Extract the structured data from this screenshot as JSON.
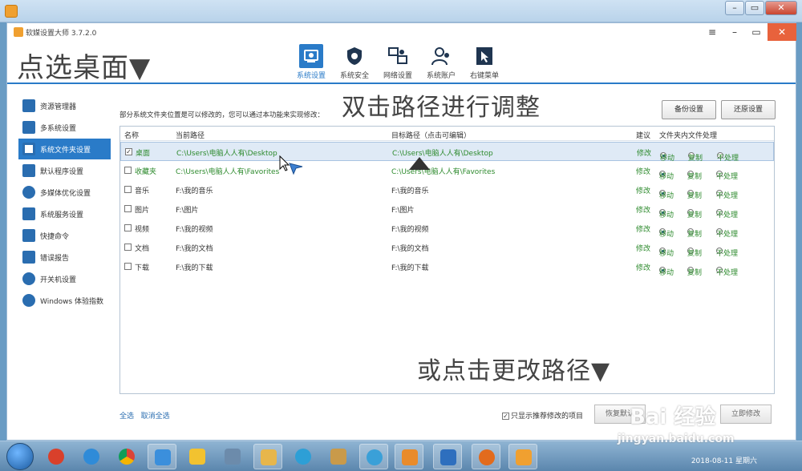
{
  "window": {
    "title": "软媒设置大师 3.7.2.0",
    "menu_icon": "≡",
    "min_icon": "–",
    "max_icon": "▭",
    "close_icon": "✕"
  },
  "annotations": {
    "left": "点选桌面▼",
    "middle": "双击路径进行调整",
    "bottom": "或点击更改路径▼"
  },
  "nav": [
    {
      "label": "系统设置",
      "icon": "gear-icon",
      "active": true
    },
    {
      "label": "系统安全",
      "icon": "shield-icon"
    },
    {
      "label": "网络设置",
      "icon": "network-icon"
    },
    {
      "label": "系统账户",
      "icon": "users-icon"
    },
    {
      "label": "右键菜单",
      "icon": "cursor-icon"
    }
  ],
  "sidebar": [
    {
      "label": "资源管理器"
    },
    {
      "label": "多系统设置"
    },
    {
      "label": "系统文件夹设置",
      "active": true
    },
    {
      "label": "默认程序设置"
    },
    {
      "label": "多媒体优化设置"
    },
    {
      "label": "系统服务设置"
    },
    {
      "label": "快捷命令"
    },
    {
      "label": "错误报告"
    },
    {
      "label": "开关机设置"
    },
    {
      "label": "Windows 体验指数"
    }
  ],
  "description": "部分系统文件夹位置是可以修改的，您可以通过本功能来实现修改：",
  "buttons": {
    "backup": "备份设置",
    "restore": "还原设置"
  },
  "table": {
    "headers": {
      "name": "名称",
      "current": "当前路径",
      "target": "目标路径（点击可编辑）",
      "suggest": "建议",
      "handling": "文件夹内文件处理"
    },
    "options": [
      "移动",
      "复制",
      "不处理"
    ],
    "rows": [
      {
        "name": "桌面",
        "current": "C:\\Users\\电脑人人有\\Desktop",
        "target": "C:\\Users\\电脑人人有\\Desktop",
        "suggest": "修改",
        "checked": true,
        "highlight": true
      },
      {
        "name": "收藏夹",
        "current": "C:\\Users\\电脑人人有\\Favorites",
        "target": "C:\\Users\\电脑人人有\\Favorites",
        "suggest": "修改",
        "checked": false,
        "highlight": true
      },
      {
        "name": "音乐",
        "current": "F:\\我的音乐",
        "target": "F:\\我的音乐",
        "suggest": "修改",
        "checked": false
      },
      {
        "name": "图片",
        "current": "F:\\图片",
        "target": "F:\\图片",
        "suggest": "修改",
        "checked": false
      },
      {
        "name": "视频",
        "current": "F:\\我的视频",
        "target": "F:\\我的视频",
        "suggest": "修改",
        "checked": false
      },
      {
        "name": "文档",
        "current": "F:\\我的文档",
        "target": "F:\\我的文档",
        "suggest": "修改",
        "checked": false
      },
      {
        "name": "下载",
        "current": "F:\\我的下载",
        "target": "F:\\我的下载",
        "suggest": "修改",
        "checked": false
      }
    ]
  },
  "footer": {
    "select_all": "全选",
    "deselect_all": "取消全选",
    "only_recommended": "只显示推荐修改的项目",
    "restore_default": "恢复默认",
    "apply": "立即修改"
  },
  "taskbar": {
    "date": "2018-08-11 星期六"
  },
  "watermark": {
    "brand": "Bai 经验",
    "url": "jingyan.baidu.com"
  }
}
